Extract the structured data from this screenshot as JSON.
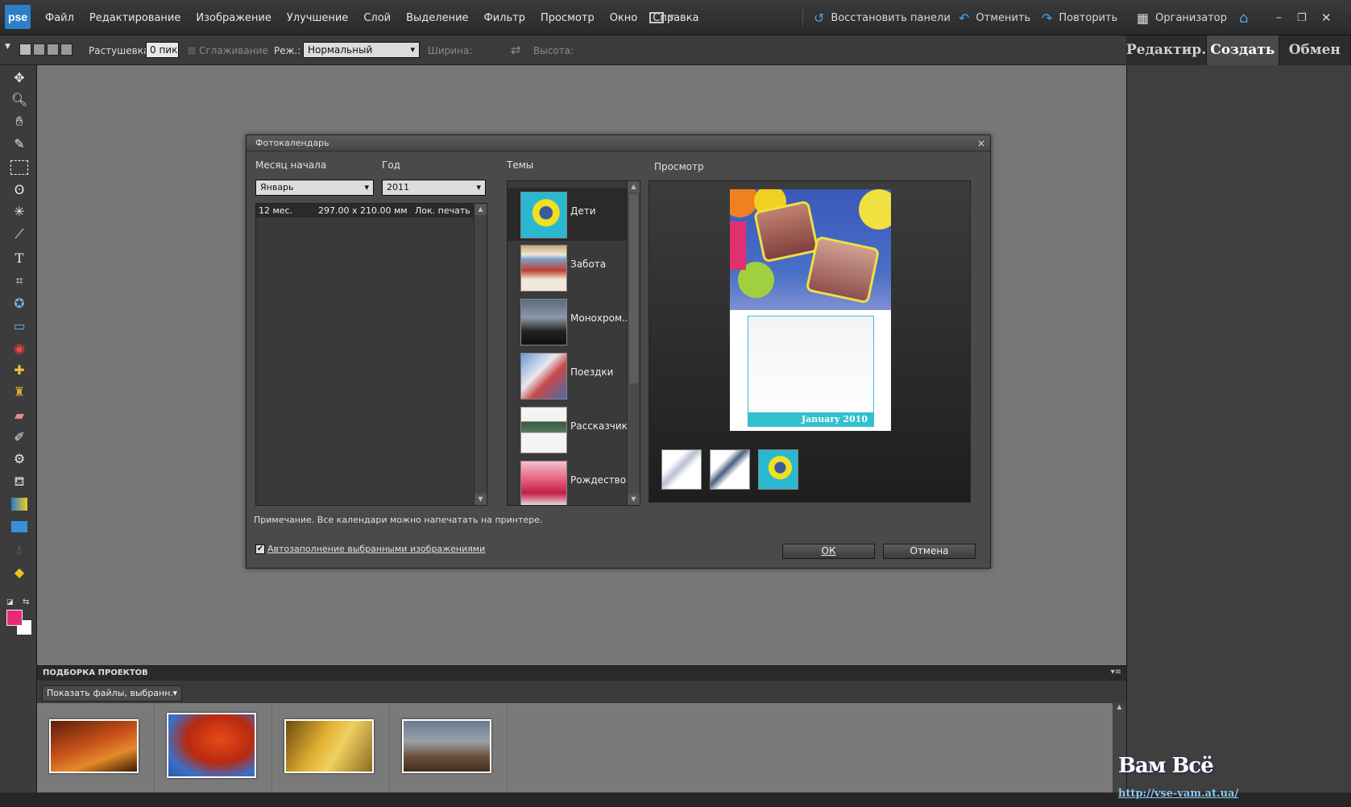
{
  "app": {
    "logo": "pse"
  },
  "menu": [
    "Файл",
    "Редактирование",
    "Изображение",
    "Улучшение",
    "Слой",
    "Выделение",
    "Фильтр",
    "Просмотр",
    "Окно",
    "Справка"
  ],
  "topbar": {
    "restore_panels": "Восстановить панели",
    "undo": "Отменить",
    "redo": "Повторить",
    "organizer": "Организатор"
  },
  "options": {
    "feather_label": "Растушевка:",
    "feather_value": "0 пикс",
    "antialias": "Сглаживание",
    "mode_label": "Реж.:",
    "mode_value": "Нормальный",
    "width": "Ширина:",
    "height": "Высота:"
  },
  "tabs": [
    "Редактир.",
    "Создать",
    "Обмен"
  ],
  "dialog": {
    "title": "Фотокалендарь",
    "close": "×",
    "start_month_label": "Месяц начала",
    "start_month_value": "Январь",
    "year_label": "Год",
    "year_value": "2011",
    "list": [
      {
        "months": "12 мес.",
        "size": "297.00 x 210.00 мм",
        "type": "Лок. печать"
      }
    ],
    "themes_label": "Темы",
    "themes": [
      "Дети",
      "Забота",
      "Монохром...",
      "Поездки",
      "Рассказчик",
      "Рождество"
    ],
    "preview_label": "Просмотр",
    "preview_caption": "January 2010",
    "note": "Примечание. Все календари можно напечатать на принтере.",
    "autofill": "Автозаполнение выбранными изображениями",
    "autofill_checked": "✔",
    "ok": "ОК",
    "cancel": "Отмена"
  },
  "bin": {
    "title": "ПОДБОРКА ПРОЕКТОВ",
    "show_files": "Показать файлы, выбранн."
  },
  "watermark": {
    "top": "Вам Всё",
    "url": "http://vse-vam.at.ua/"
  }
}
